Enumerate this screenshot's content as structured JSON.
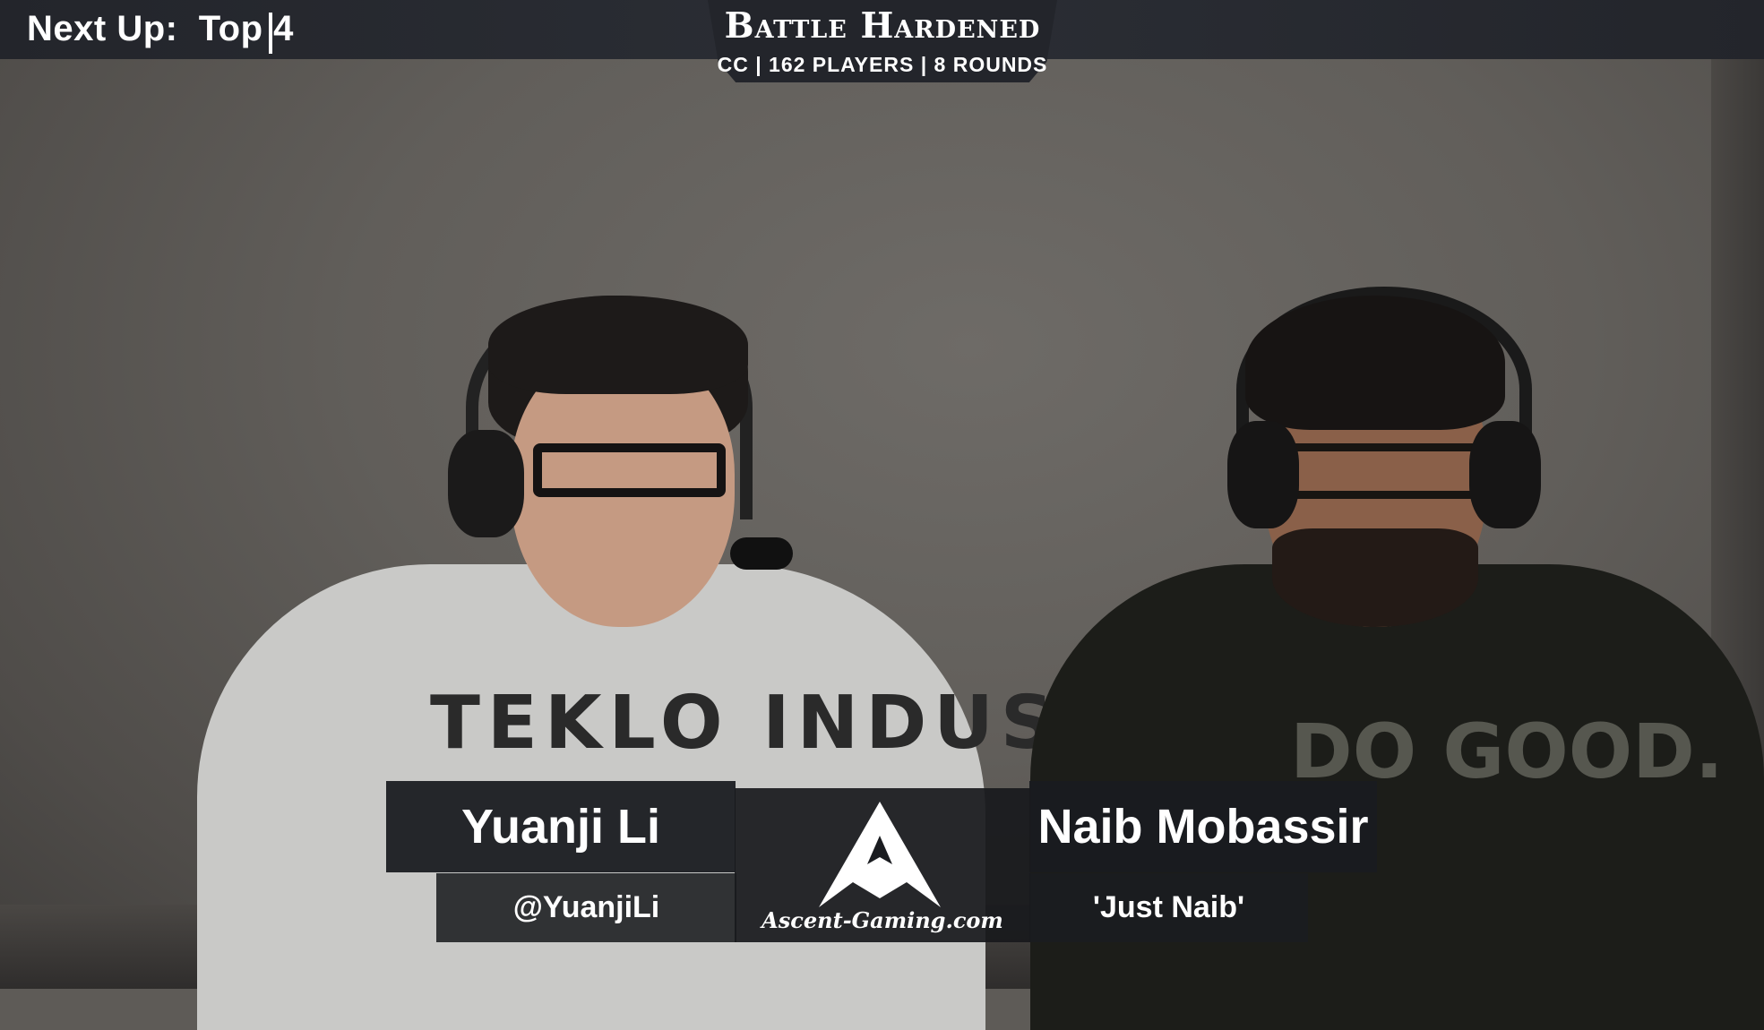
{
  "top_bar": {
    "next_up_label": "Next Up:",
    "next_up_value": "Top 4"
  },
  "event": {
    "title": "Battle Hardened",
    "subtitle": "CC | 162 PLAYERS | 8 ROUNDS"
  },
  "casters": [
    {
      "name": "Yuanji Li",
      "handle": "@YuanjiLi"
    },
    {
      "name": "Naib Mobassir",
      "handle": "'Just Naib'"
    }
  ],
  "sponsor": {
    "logo_text": "Ascent-Gaming.com"
  },
  "scene": {
    "shirt_text_left": "TEKLO INDUSTRIES",
    "shirt_text_right": "DO GOOD."
  },
  "colors": {
    "overlay_bg": "#23252b",
    "text": "#ffffff",
    "wall": "#615e5a"
  }
}
